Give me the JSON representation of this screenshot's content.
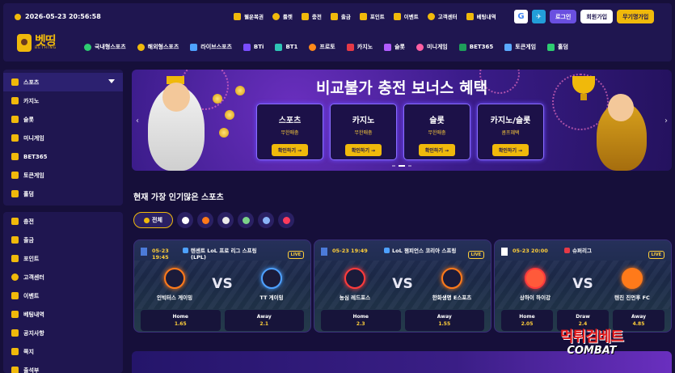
{
  "header": {
    "datetime": "2026-05-23 20:56:58",
    "top_links": [
      "웰운복권",
      "룰렛",
      "충전",
      "출금",
      "포인트",
      "이벤트",
      "고객센터",
      "베팅내역"
    ],
    "auth": {
      "google": "G",
      "telegram": "✈",
      "login": "로그인",
      "signup": "회원가입",
      "free_signup": "무기명가입"
    },
    "logo": {
      "main": "벳띵",
      "sub": "BETHING"
    },
    "categories": [
      "국내형스포츠",
      "해외형스포츠",
      "라이브스포츠",
      "BTi",
      "BT1",
      "프로토",
      "카지노",
      "슬롯",
      "미니게임",
      "BET365",
      "토큰게임",
      "홀덤"
    ]
  },
  "sidebar": {
    "group1": [
      {
        "label": "스포츠",
        "active": true
      },
      {
        "label": "카지노"
      },
      {
        "label": "슬롯"
      },
      {
        "label": "미니게임"
      },
      {
        "label": "BET365"
      },
      {
        "label": "토큰게임"
      },
      {
        "label": "홀덤"
      }
    ],
    "group2": [
      {
        "label": "충전"
      },
      {
        "label": "출금"
      },
      {
        "label": "포인트"
      },
      {
        "label": "고객센터"
      },
      {
        "label": "이벤트"
      },
      {
        "label": "베팅내역"
      },
      {
        "label": "공지사항"
      },
      {
        "label": "쪽지"
      },
      {
        "label": "출석부"
      }
    ]
  },
  "banner": {
    "title": "비교불가 충전 보너스 혜택",
    "promos": [
      {
        "title": "스포츠",
        "sub": "무한매충",
        "button": "확인하기 →"
      },
      {
        "title": "카지노",
        "sub": "무한매충",
        "button": "확인하기 →"
      },
      {
        "title": "슬롯",
        "sub": "무한매충",
        "button": "확인하기 →"
      },
      {
        "title": "카지노/슬롯",
        "sub": "콤프혜택",
        "button": "확인하기 →"
      }
    ]
  },
  "section": {
    "title": "현재 가장 인기많은 스포츠",
    "filter_all": "전체"
  },
  "matches": [
    {
      "time": "05-23 19:45",
      "league": "텐센트 LoL 프로 리그 스프링 (LPL)",
      "live": "LIVE",
      "home": "인빅터스 게이밍",
      "away": "TT 게이밍",
      "vs": "VS",
      "odds": [
        {
          "label": "Home",
          "value": "1.65"
        },
        {
          "label": "Away",
          "value": "2.1"
        }
      ]
    },
    {
      "time": "05-23 19:49",
      "league": "LoL 챔피언스 코리아 스프링",
      "live": "LIVE",
      "home": "농심 레드포스",
      "away": "한화생명 E스포츠",
      "vs": "VS",
      "odds": [
        {
          "label": "Home",
          "value": "2.3"
        },
        {
          "label": "Away",
          "value": "1.55"
        }
      ]
    },
    {
      "time": "05-23 20:00",
      "league": "슈퍼리그",
      "live": "LIVE",
      "home": "상하이 하이강",
      "away": "텐진 진먼후 FC",
      "vs": "VS",
      "odds": [
        {
          "label": "Home",
          "value": "2.05"
        },
        {
          "label": "Draw",
          "value": "2.4"
        },
        {
          "label": "Away",
          "value": "4.85"
        }
      ]
    }
  ],
  "watermark": {
    "main": "먹튀검베트",
    "sub": "COMBAT"
  },
  "colors": {
    "background": "#160f3a",
    "panel": "#1f1650",
    "accent": "#f0b90b",
    "primary": "#6a4fe0",
    "odds_value": "#ffcf3a"
  }
}
